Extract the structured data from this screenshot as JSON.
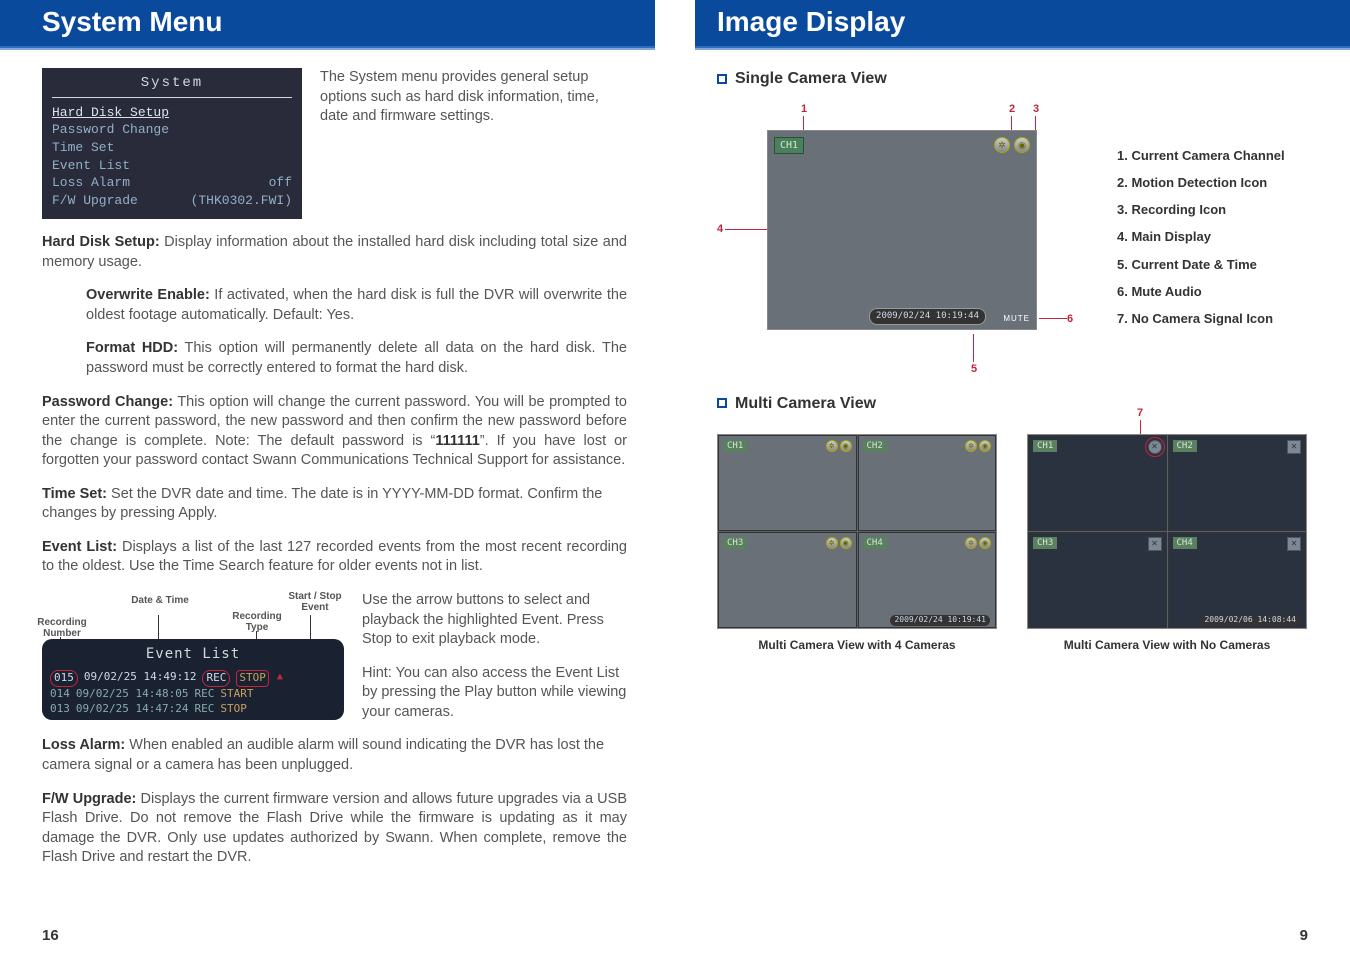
{
  "left": {
    "title": "System Menu",
    "systemBox": {
      "title": "System",
      "rows": [
        {
          "label": "Hard Disk Setup",
          "value": ""
        },
        {
          "label": "Password Change",
          "value": ""
        },
        {
          "label": "Time Set",
          "value": ""
        },
        {
          "label": "Event List",
          "value": ""
        },
        {
          "label": "Loss Alarm",
          "value": "off"
        },
        {
          "label": "F/W Upgrade",
          "value": "(THK0302.FWI)"
        }
      ]
    },
    "intro": "The System menu provides general setup options such as hard disk information, time, date and firmware settings.",
    "hd_setup_label": "Hard Disk Setup:",
    "hd_setup_text": "  Display information about the installed hard disk including total size and memory usage.",
    "overwrite_label": "Overwrite Enable:",
    "overwrite_text": "  If activated, when the hard disk is full the DVR will overwrite the oldest footage automatically. Default: Yes.",
    "format_label": "Format HDD:",
    "format_text": "  This option will permanently delete all data on the hard disk.  The password must be correctly entered to format the hard disk.",
    "pwchange_label": "Password Change:",
    "pwchange_text_a": "  This option will change the current password.  You will be prompted to enter the current password, the new password and then confirm the new password before the change is complete.   Note: The default password is “",
    "pwchange_default": "111111",
    "pwchange_text_b": "”.  If you have lost or forgotten your password contact Swann Communications Technical Support for assistance.",
    "timeset_label": "Time Set:",
    "timeset_text": "  Set the DVR date and time.  The date is in YYYY-MM-DD format.  Confirm the changes by pressing Apply.",
    "eventlist_label": "Event List:",
    "eventlist_text": "  Displays a list of the last 127 recorded events from the most recent recording to the oldest.  Use the Time Search feature for older events not in list.",
    "eventListCallouts": {
      "rec_num": "Recording Number",
      "date_time": "Date & Time",
      "rec_type": "Recording Type",
      "start_stop": "Start / Stop Event"
    },
    "eventListBox": {
      "title": "Event List",
      "rows": [
        {
          "num": "015",
          "dt": "09/02/25 14:49:12",
          "type": "REC",
          "ev": "STOP"
        },
        {
          "num": "014",
          "dt": "09/02/25 14:48:05",
          "type": "REC",
          "ev": "START"
        },
        {
          "num": "013",
          "dt": "09/02/25 14:47:24",
          "type": "REC",
          "ev": "STOP"
        }
      ]
    },
    "event_use_text": "Use the arrow buttons to select and playback the highlighted Event.  Press Stop to exit playback mode.",
    "event_hint_text": "Hint:  You can also access the Event List by pressing the Play button while viewing your cameras.",
    "loss_label": "Loss Alarm:",
    "loss_text": "  When enabled an audible alarm will sound indicating the DVR has lost the camera signal or a camera has been unplugged.",
    "fw_label": "F/W Upgrade:",
    "fw_text": "  Displays the current firmware version and allows future upgrades via a USB Flash Drive.  Do not remove the Flash Drive while the firmware is updating as it may damage the DVR.  Only use updates authorized by Swann.  When complete, remove the Flash Drive and restart the DVR.",
    "page_num": "16"
  },
  "right": {
    "title": "Image Display",
    "single_heading": "Single Camera View",
    "single_cam_label": "CH1",
    "single_cam_time": "2009/02/24 10:19:44",
    "single_cam_mute": "MUTE",
    "callouts": [
      "1",
      "2",
      "3",
      "4",
      "5",
      "6",
      "7"
    ],
    "legend": [
      "1.  Current Camera Channel",
      "2.  Motion Detection Icon",
      "3.  Recording Icon",
      "4.  Main Display",
      "5.  Current Date & Time",
      "6.  Mute Audio",
      "7.  No Camera Signal Icon"
    ],
    "multi_heading": "Multi Camera View",
    "multi4": {
      "cells": [
        "CH1",
        "CH2",
        "CH3",
        "CH4"
      ],
      "time": "2009/02/24 10:19:41",
      "caption": "Multi Camera View with 4 Cameras"
    },
    "multi0": {
      "cells": [
        "CH1",
        "CH2",
        "CH3",
        "CH4"
      ],
      "time": "2009/02/06 14:08:44",
      "caption": "Multi Camera View with No Cameras"
    },
    "page_num": "9"
  }
}
